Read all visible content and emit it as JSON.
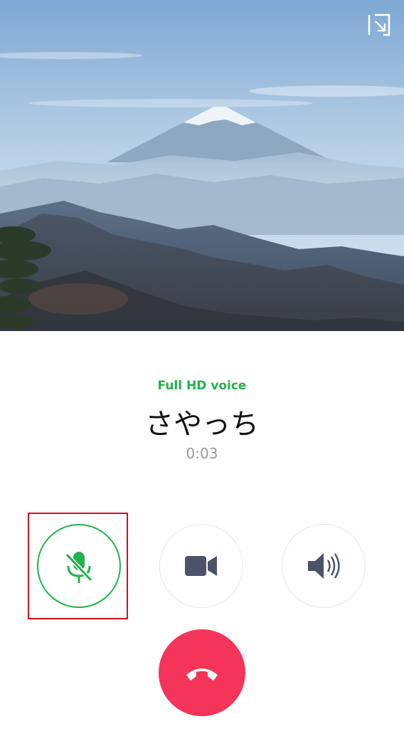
{
  "call": {
    "quality_label": "Full HD voice",
    "caller_name": "さやっち",
    "duration": "0:03"
  },
  "controls": {
    "mute": {
      "icon": "microphone-muted-icon",
      "state": "muted"
    },
    "video": {
      "icon": "video-camera-icon"
    },
    "speaker": {
      "icon": "speaker-icon"
    },
    "end_call": {
      "icon": "phone-hangup-icon"
    },
    "minimize": {
      "icon": "minimize-arrow-icon"
    }
  },
  "colors": {
    "accent_green": "#21b34a",
    "end_call_red": "#f5345a",
    "icon_slate": "#4c5268",
    "highlight_red": "#d0101e"
  }
}
